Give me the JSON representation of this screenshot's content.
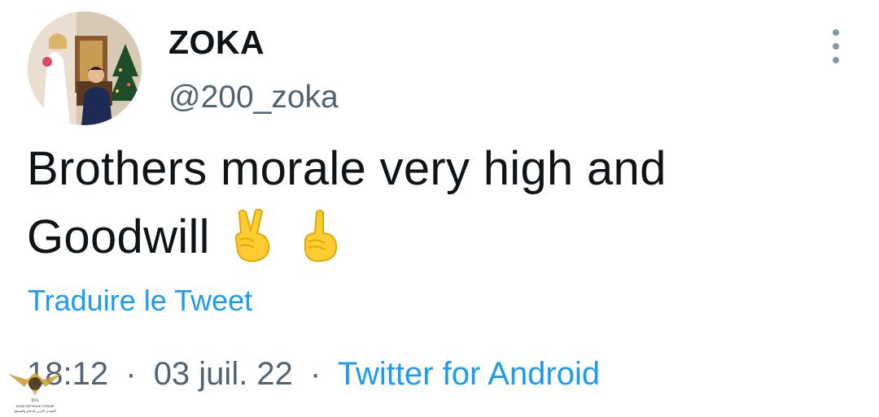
{
  "tweet": {
    "display_name": "ZOKA",
    "handle": "@200_zoka",
    "text_line1": "Brothers morale very high and",
    "text_line2": "Goodwill",
    "emojis": [
      "victory-hand-emoji",
      "index-pointing-up-emoji"
    ],
    "translate_label": "Traduire le Tweet",
    "time": "18:12",
    "separator": "·",
    "date": "03 juil. 22",
    "source": "Twitter for Android"
  },
  "watermark": {
    "initials": "DA",
    "line1": "ARAB DEFENSE FORUM",
    "line2": "المنتدى العربي للدفاع والتسليح"
  },
  "colors": {
    "link": "#1d9bf0",
    "secondary_text": "#536471",
    "primary_text": "#0f1419",
    "emoji_yellow": "#ffcc33"
  }
}
